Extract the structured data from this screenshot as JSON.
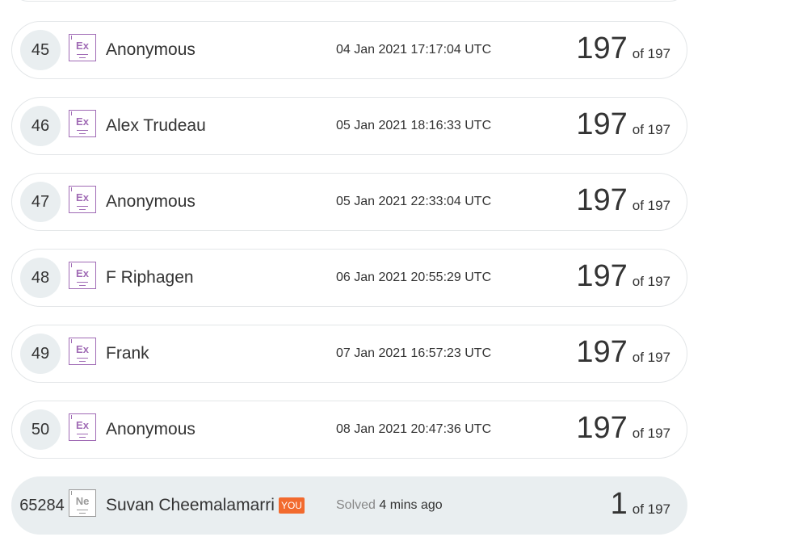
{
  "leaderboard": {
    "rows": [
      {
        "rank": "45",
        "badge": "Ex",
        "name": "Anonymous",
        "time": "04 Jan 2021 17:17:04 UTC",
        "score": "197",
        "of_label": "of 197"
      },
      {
        "rank": "46",
        "badge": "Ex",
        "name": "Alex Trudeau",
        "time": "05 Jan 2021 18:16:33 UTC",
        "score": "197",
        "of_label": "of 197"
      },
      {
        "rank": "47",
        "badge": "Ex",
        "name": "Anonymous",
        "time": "05 Jan 2021 22:33:04 UTC",
        "score": "197",
        "of_label": "of 197"
      },
      {
        "rank": "48",
        "badge": "Ex",
        "name": "F Riphagen",
        "time": "06 Jan 2021 20:55:29 UTC",
        "score": "197",
        "of_label": "of 197"
      },
      {
        "rank": "49",
        "badge": "Ex",
        "name": "Frank",
        "time": "07 Jan 2021 16:57:23 UTC",
        "score": "197",
        "of_label": "of 197"
      },
      {
        "rank": "50",
        "badge": "Ex",
        "name": "Anonymous",
        "time": "08 Jan 2021 20:47:36 UTC",
        "score": "197",
        "of_label": "of 197"
      }
    ],
    "current_user": {
      "rank": "65284",
      "badge": "Ne",
      "name": "Suvan Cheemalamarri",
      "you_label": "YOU",
      "solved_label": "Solved",
      "solved_ago": "4 mins ago",
      "score": "1",
      "of_label": "of 197"
    }
  },
  "colors": {
    "expert_badge": "#a06bb5",
    "newbie_badge": "#9a9a9a",
    "you_badge": "#f26a2e",
    "row_highlight": "#e9eef0"
  }
}
